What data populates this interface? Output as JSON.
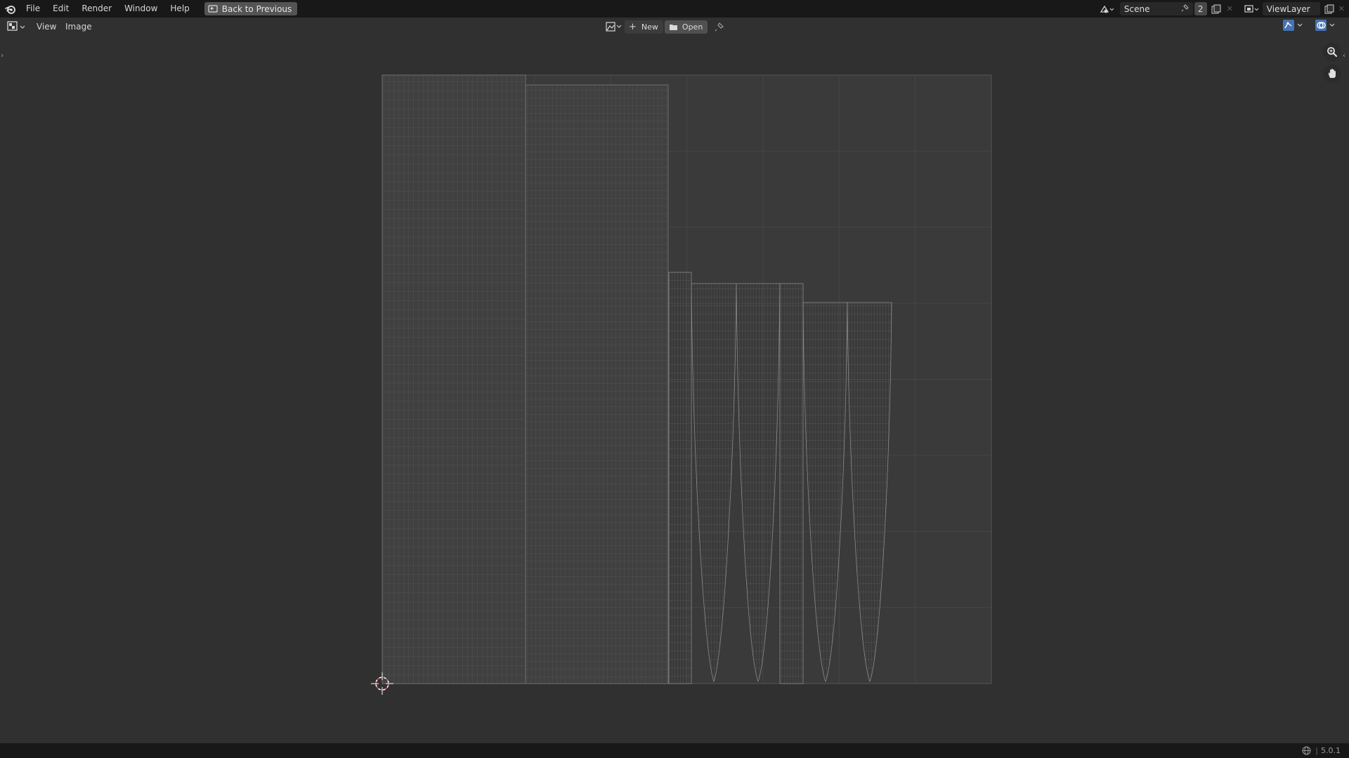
{
  "topbar": {
    "menus": [
      "File",
      "Edit",
      "Render",
      "Window",
      "Help"
    ],
    "back_label": "Back to Previous",
    "scene_name": "Scene",
    "scene_users": "2",
    "view_layer": "ViewLayer"
  },
  "editor_header": {
    "menus": [
      "View",
      "Image"
    ],
    "new_label": "New",
    "open_label": "Open"
  },
  "status": {
    "version": "5.0.1"
  },
  "colors": {
    "topbar_bg": "#181818",
    "viewport_bg": "#303030",
    "uv_bounds_bg": "#3a3a3a",
    "wire": "#8a8a8a",
    "accent_blue": "#4772b3",
    "cursor_red": "#e06060"
  },
  "icons": {
    "app": "blender-logo-icon",
    "back": "back-to-previous-icon",
    "editor_type": "image-editor-icon",
    "new": "plus-icon",
    "open": "folder-icon",
    "pin": "pin-icon",
    "zoom": "zoom-icon",
    "pan": "hand-icon",
    "cursor": "2d-cursor-icon"
  }
}
